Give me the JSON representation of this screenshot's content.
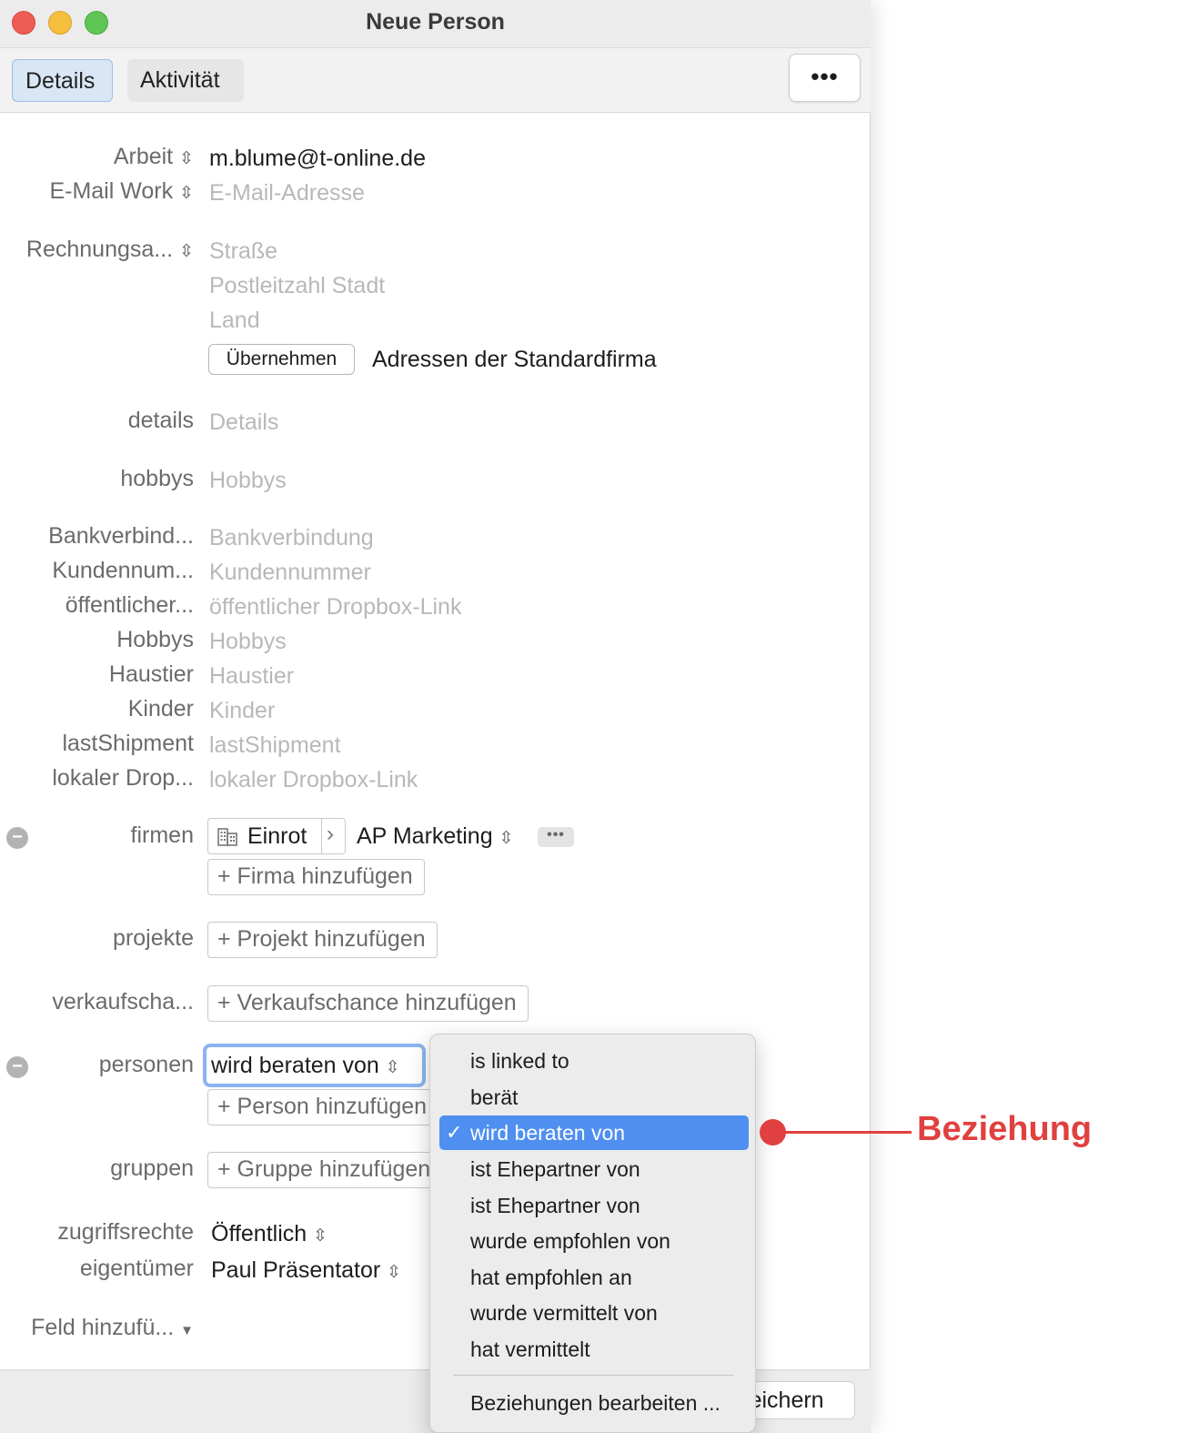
{
  "window": {
    "title": "Neue Person"
  },
  "toolbar": {
    "tabs": [
      "Details",
      "Aktivität"
    ],
    "more_label": "•••"
  },
  "form": {
    "email1": {
      "label": "Arbeit",
      "value": "m.blume@t-online.de"
    },
    "email2": {
      "label": "E-Mail Work",
      "placeholder": "E-Mail-Adresse"
    },
    "address": {
      "label": "Rechnungsa...",
      "street": "Straße",
      "city": "Postleitzahl Stadt",
      "country": "Land",
      "apply_button": "Übernehmen",
      "apply_text": "Adressen der Standardfirma"
    },
    "details": {
      "label": "details",
      "placeholder": "Details"
    },
    "hobbys": {
      "label": "hobbys",
      "placeholder": "Hobbys"
    },
    "custom_fields": [
      {
        "label": "Bankverbind...",
        "placeholder": "Bankverbindung"
      },
      {
        "label": "Kundennum...",
        "placeholder": "Kundennummer"
      },
      {
        "label": "öffentlicher...",
        "placeholder": "öffentlicher Dropbox-Link"
      },
      {
        "label": "Hobbys",
        "placeholder": "Hobbys"
      },
      {
        "label": "Haustier",
        "placeholder": "Haustier"
      },
      {
        "label": "Kinder",
        "placeholder": "Kinder"
      },
      {
        "label": "lastShipment",
        "placeholder": "lastShipment"
      },
      {
        "label": "lokaler Drop...",
        "placeholder": "lokaler Dropbox-Link"
      }
    ],
    "firmen": {
      "label": "firmen",
      "company": "Einrot",
      "role": "AP Marketing",
      "add": "+ Firma hinzufügen"
    },
    "projekte": {
      "label": "projekte",
      "add": "+ Projekt hinzufügen"
    },
    "verkaufschancen": {
      "label": "verkaufscha...",
      "add": "+ Verkaufschance hinzufügen"
    },
    "personen": {
      "label": "personen",
      "relation": "wird beraten von",
      "add": "+ Person hinzufügen"
    },
    "gruppen": {
      "label": "gruppen",
      "add": "+ Gruppe hinzufügen"
    },
    "zugriffsrechte": {
      "label": "zugriffsrechte",
      "value": "Öffentlich"
    },
    "eigentuemer": {
      "label": "eigentümer",
      "value": "Paul Präsentator"
    },
    "add_field": "Feld hinzufü..."
  },
  "footer": {
    "save_label": "Speichern"
  },
  "menu": {
    "items": [
      "is linked to",
      "berät",
      "wird beraten von",
      "ist Ehepartner von",
      "ist Ehepartner von",
      "wurde empfohlen von",
      "hat empfohlen an",
      "wurde vermittelt von",
      "hat vermittelt"
    ],
    "selected_index": 2,
    "edit_item": "Beziehungen bearbeiten ..."
  },
  "annotation": {
    "text": "Beziehung",
    "color": "#e0403f"
  }
}
